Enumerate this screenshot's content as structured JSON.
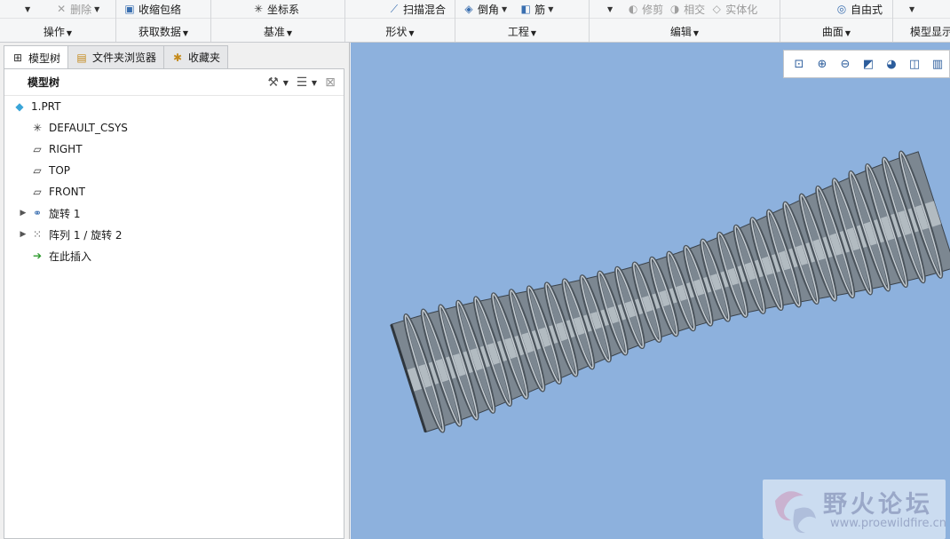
{
  "ribbon": {
    "groups": [
      {
        "label": "操作",
        "items": [
          {
            "label": "",
            "icon": "caret-down",
            "disabled": false
          }
        ]
      },
      {
        "label": "",
        "items": [
          {
            "label": "删除",
            "icon": "delete-icon",
            "disabled": true
          }
        ]
      },
      {
        "label": "获取数据",
        "items": [
          {
            "label": "收缩包络",
            "icon": "shrinkwrap-icon",
            "disabled": false
          }
        ]
      },
      {
        "label": "基准",
        "items": [
          {
            "label": "坐标系",
            "icon": "csys-icon",
            "disabled": false
          }
        ]
      },
      {
        "label": "形状",
        "items": [
          {
            "label": "扫描混合",
            "icon": "swept-blend-icon",
            "disabled": false
          }
        ]
      },
      {
        "label": "工程",
        "items": [
          {
            "label": "倒角",
            "icon": "chamfer-icon",
            "disabled": false
          },
          {
            "label": "筋",
            "icon": "rib-icon",
            "disabled": false
          }
        ]
      },
      {
        "label": "编辑",
        "items": [
          {
            "label": "修剪",
            "icon": "trim-icon",
            "disabled": true
          },
          {
            "label": "相交",
            "icon": "intersect-icon",
            "disabled": true
          },
          {
            "label": "实体化",
            "icon": "solidify-icon",
            "disabled": true
          }
        ]
      },
      {
        "label": "曲面",
        "items": [
          {
            "label": "自由式",
            "icon": "freestyle-icon",
            "disabled": false
          }
        ]
      },
      {
        "label": "模型显示",
        "items": []
      }
    ]
  },
  "left_panel": {
    "tabs": [
      {
        "label": "模型树",
        "icon": "model-tree-icon",
        "active": true
      },
      {
        "label": "文件夹浏览器",
        "icon": "folder-browser-icon",
        "active": false
      },
      {
        "label": "收藏夹",
        "icon": "favorites-icon",
        "active": false
      }
    ],
    "tree_title": "模型树",
    "tree_items": [
      {
        "label": "1.PRT",
        "icon": "part-icon",
        "expandable": false
      },
      {
        "label": "DEFAULT_CSYS",
        "icon": "csys-icon",
        "expandable": false
      },
      {
        "label": "RIGHT",
        "icon": "datum-plane-icon",
        "expandable": false
      },
      {
        "label": "TOP",
        "icon": "datum-plane-icon",
        "expandable": false
      },
      {
        "label": "FRONT",
        "icon": "datum-plane-icon",
        "expandable": false
      },
      {
        "label": "旋转 1",
        "icon": "revolve-icon",
        "expandable": true
      },
      {
        "label": "阵列 1 / 旋转 2",
        "icon": "pattern-icon",
        "expandable": true
      },
      {
        "label": "在此插入",
        "icon": "insert-here-arrow-icon",
        "expandable": false
      }
    ]
  },
  "viewport": {
    "background_color": "#8db1dd",
    "model_color": "#7c8791",
    "view_tools": [
      "refit-icon",
      "zoom-in-icon",
      "zoom-out-icon",
      "repaint-icon",
      "shading-icon",
      "saved-views-icon",
      "display-style-icon"
    ]
  },
  "watermark": {
    "title": "野火论坛",
    "url": "www.proewildfire.cn"
  }
}
